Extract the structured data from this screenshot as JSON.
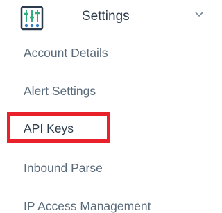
{
  "sidebar": {
    "header": {
      "icon": "sliders-icon",
      "label": "Settings",
      "chevron_icon": "chevron-down-icon"
    },
    "items": [
      {
        "label": "Account Details"
      },
      {
        "label": "Alert Settings"
      },
      {
        "label": "API Keys",
        "highlighted": true
      },
      {
        "label": "Inbound Parse"
      },
      {
        "label": "IP Access Management"
      }
    ]
  },
  "colors": {
    "highlight": "#e8212b",
    "icon_green": "#2fae7a",
    "icon_blue": "#2f7fc8",
    "text_primary": "#2b3b4b",
    "text_secondary": "#596a7a"
  }
}
